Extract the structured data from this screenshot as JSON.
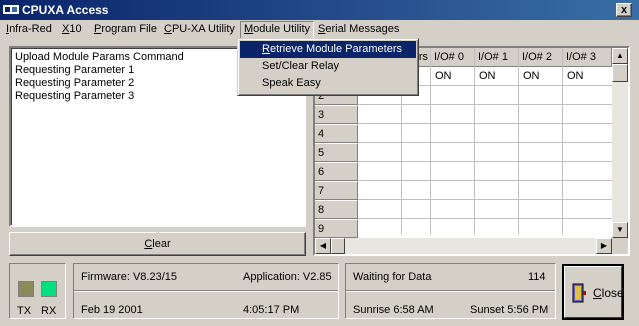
{
  "window": {
    "title": "CPUXA Access",
    "close_glyph": "x"
  },
  "menu": {
    "items": [
      {
        "label": "Infra-Red",
        "ul": "I",
        "rest": "nfra-Red"
      },
      {
        "label": "X10",
        "ul": "X",
        "rest": "10"
      },
      {
        "label": "Program File",
        "ul": "P",
        "rest": "rogram File"
      },
      {
        "label": "CPU-XA Utility",
        "ul": "C",
        "rest": "PU-XA Utility"
      },
      {
        "label": "Module Utility",
        "ul": "M",
        "rest": "odule Utility"
      },
      {
        "label": "Serial Messages",
        "ul": "S",
        "rest": "erial Messages"
      }
    ]
  },
  "dropdown": {
    "items": [
      {
        "label": "Retrieve Module Parameters",
        "ul": "R",
        "rest": "etrieve Module Parameters",
        "selected": true
      },
      {
        "label": "Set/Clear Relay",
        "ul": "",
        "rest": "Set/Clear Relay",
        "selected": false
      },
      {
        "label": "Speak Easy",
        "ul": "",
        "rest": "Speak Easy",
        "selected": false
      }
    ]
  },
  "log": {
    "lines": [
      "Upload Module Params Command",
      "Requesting Parameter 1",
      "Requesting Parameter 2",
      "Requesting Parameter 3"
    ]
  },
  "clear_button": {
    "ul": "C",
    "rest": "lear"
  },
  "grid": {
    "header_partial": "rs",
    "columns": [
      "I/O# 0",
      "I/O# 1",
      "I/O# 2",
      "I/O# 3"
    ],
    "row1_values": [
      "ON",
      "ON",
      "ON",
      "ON"
    ],
    "row_labels": [
      "2",
      "3",
      "4",
      "5",
      "6",
      "7",
      "8",
      "9"
    ]
  },
  "leds": {
    "tx_label": "TX",
    "rx_label": "RX",
    "tx_color": "#8a8a5a",
    "rx_color": "#00e080"
  },
  "info": {
    "firmware": "Firmware: V8.23/15",
    "application": "Application: V2.85",
    "date": "Feb 19 2001",
    "time": "4:05:17 PM"
  },
  "status": {
    "message": "Waiting for Data",
    "count": "114",
    "sunrise": "Sunrise 6:58 AM",
    "sunset": "Sunset 5:56 PM"
  },
  "close_button": {
    "ul": "C",
    "rest": "lose"
  }
}
